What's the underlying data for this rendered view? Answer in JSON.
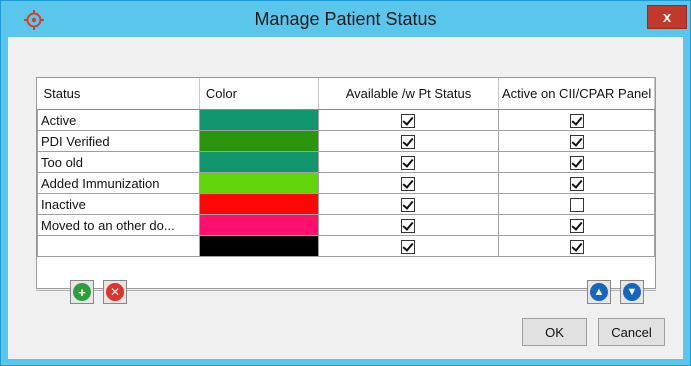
{
  "window": {
    "title": "Manage Patient Status",
    "close_label": "x"
  },
  "table": {
    "columns": [
      "Status",
      "Color",
      "Available /w Pt Status",
      "Active on CII/CPAR Panel"
    ],
    "rows": [
      {
        "status": "Active",
        "color": "#12966e",
        "available": true,
        "active_panel": true
      },
      {
        "status": "PDI Verified",
        "color": "#2b960d",
        "available": true,
        "active_panel": true
      },
      {
        "status": "Too old",
        "color": "#12966e",
        "available": true,
        "active_panel": true
      },
      {
        "status": "Added Immunization",
        "color": "#62d40a",
        "available": true,
        "active_panel": true
      },
      {
        "status": "Inactive",
        "color": "#fc0606",
        "available": true,
        "active_panel": false
      },
      {
        "status": "Moved to an other do...",
        "color": "#ff0f6e",
        "available": true,
        "active_panel": true
      },
      {
        "status": "",
        "color": "#000000",
        "available": true,
        "active_panel": true
      }
    ]
  },
  "icons": {
    "app": "target-icon",
    "add": "plus-icon",
    "remove": "x-icon",
    "move_up": "arrow-up-icon",
    "move_down": "arrow-down-icon"
  },
  "buttons": {
    "ok": "OK",
    "cancel": "Cancel"
  },
  "accent": {
    "titlebar": "#5bc6ec",
    "add": "#2e9e3a",
    "remove": "#e0342a",
    "move": "#1566c0",
    "close": "#c0392b"
  }
}
